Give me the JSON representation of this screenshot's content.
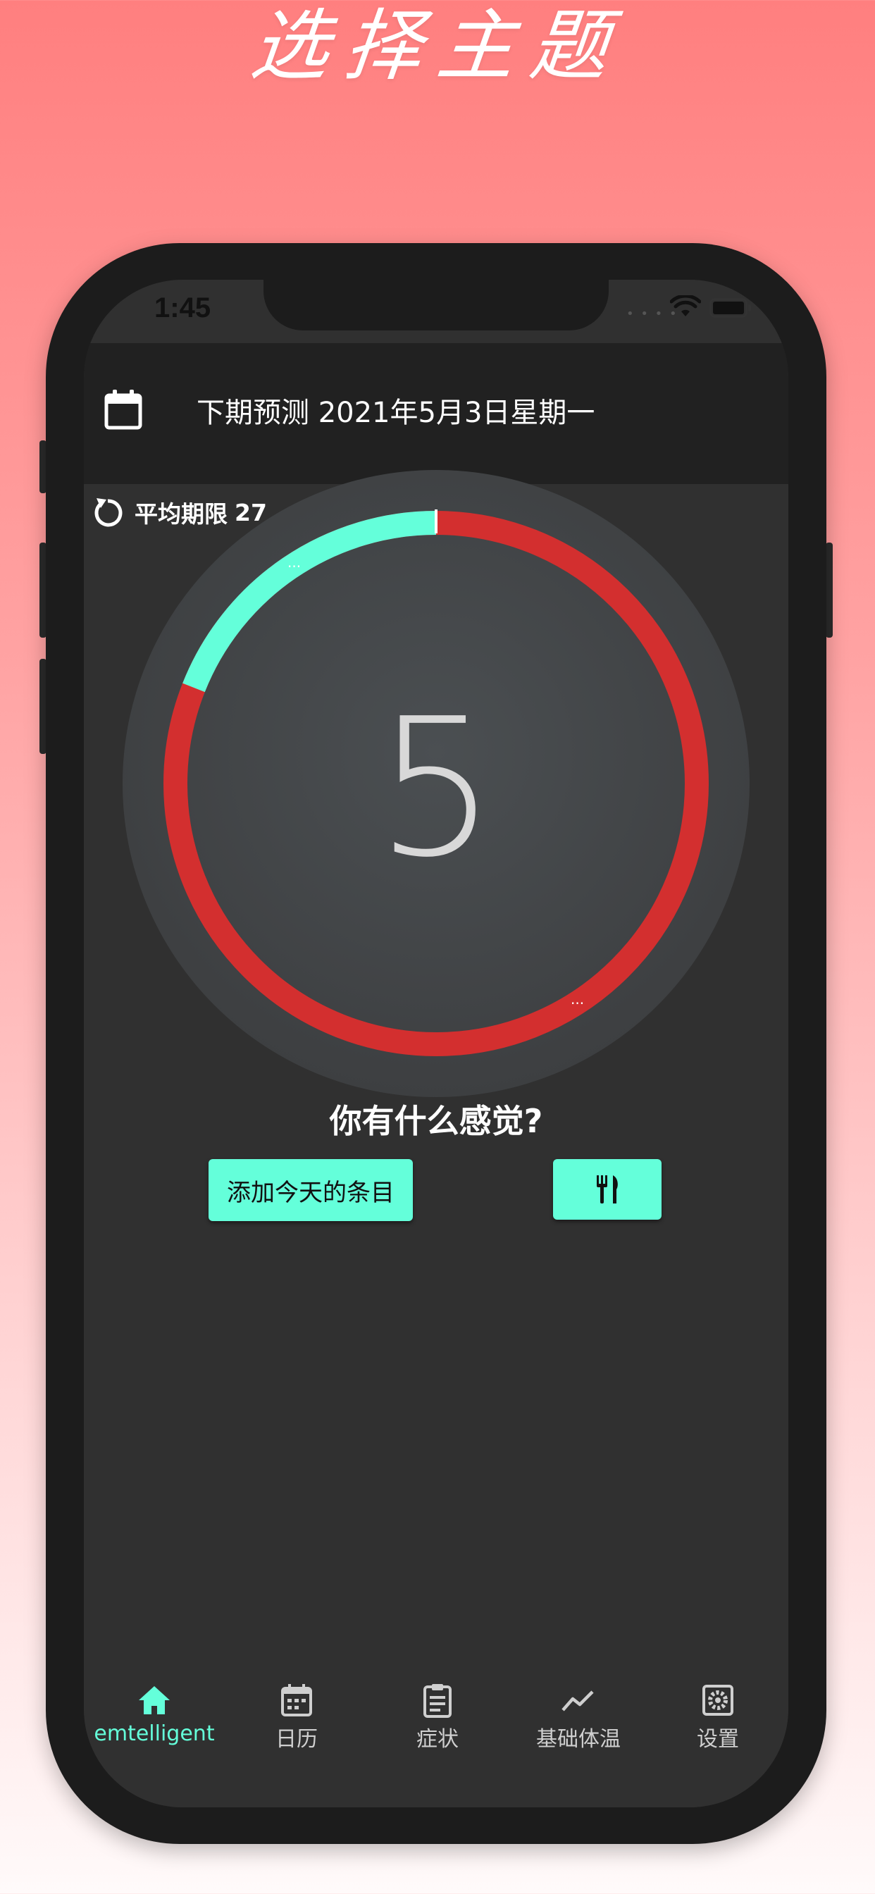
{
  "promo": {
    "title": "选择主题"
  },
  "status": {
    "time": "1:45"
  },
  "header": {
    "title": "下期预测 2021年5月3日星期一"
  },
  "average": {
    "label": "平均期限",
    "value": "27"
  },
  "cycle": {
    "day": "5",
    "progress_fraction": 0.19,
    "colors": {
      "progress": "#64ffda",
      "remaining": "#d32f2f",
      "disc": "#454545",
      "background": "#303030"
    }
  },
  "prompt": {
    "question": "你有什么感觉?"
  },
  "actions": {
    "add_today": "添加今天的条目",
    "meal_icon": "utensils-icon"
  },
  "tabs": [
    {
      "label": "emtelligent",
      "icon": "home-icon",
      "active": true
    },
    {
      "label": "日历",
      "icon": "calendar-icon",
      "active": false
    },
    {
      "label": "症状",
      "icon": "clipboard-icon",
      "active": false
    },
    {
      "label": "基础体温",
      "icon": "trend-icon",
      "active": false
    },
    {
      "label": "设置",
      "icon": "settings-icon",
      "active": false
    }
  ],
  "colors": {
    "accent": "#64ffda",
    "appbar": "#212121",
    "page_gradient_top": "#ff7f7f"
  }
}
